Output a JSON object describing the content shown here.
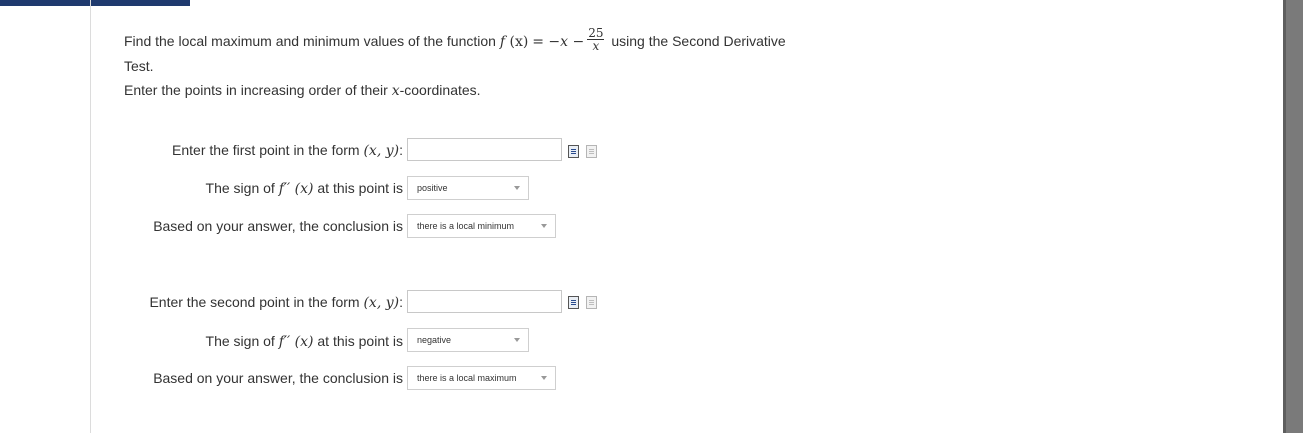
{
  "question": {
    "text_before": "Find the local maximum and minimum values of the function ",
    "function_name": "f",
    "function_arg": "(x)",
    "equals": "= ",
    "rhs_prefix": "−x −",
    "frac_num": "25",
    "frac_den": "x",
    "text_after": " using the Second Derivative",
    "line2": "Test."
  },
  "instruction": {
    "before": "Enter the points in increasing order of their ",
    "var": "x",
    "after": "-coordinates."
  },
  "point1": {
    "label_text": "Enter the first point in the form ",
    "form_math": "(x,  y)",
    "colon": ":",
    "value": "",
    "sign_label_before": "The sign of ",
    "sign_label_math": "f′′ (x)",
    "sign_label_after": " at this point is",
    "sign_value": "positive",
    "conclusion_label": "Based on your answer, the conclusion is",
    "conclusion_value": "there is a local minimum"
  },
  "point2": {
    "label_text": "Enter the second point in the form ",
    "form_math": "(x,  y)",
    "colon": ":",
    "value": "",
    "sign_label_before": "The sign of ",
    "sign_label_math": "f′′ (x)",
    "sign_label_after": " at this point is",
    "sign_value": "negative",
    "conclusion_label": "Based on your answer, the conclusion is",
    "conclusion_value": "there is a local maximum"
  },
  "icons": {
    "edit": "equation-editor-icon",
    "preview": "preview-icon"
  },
  "colors": {
    "top_bar": "#1f3a6e",
    "scrollbar": "#7a7a7a"
  }
}
